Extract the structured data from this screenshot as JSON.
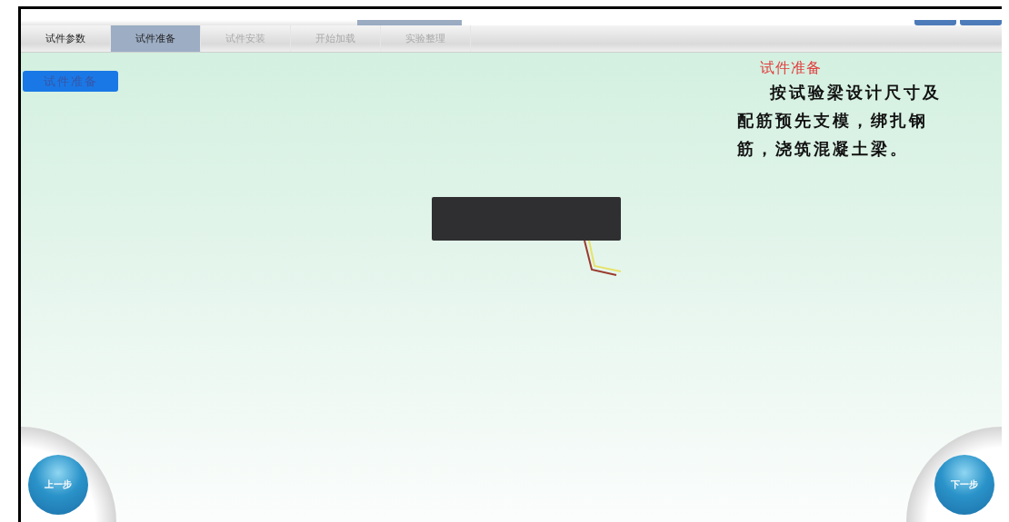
{
  "tabs": [
    {
      "label": "试件参数",
      "selected": false,
      "disabled": false
    },
    {
      "label": "试件准备",
      "selected": true,
      "disabled": false
    },
    {
      "label": "试件安装",
      "selected": false,
      "disabled": true
    },
    {
      "label": "开始加载",
      "selected": false,
      "disabled": true
    },
    {
      "label": "实验整理",
      "selected": false,
      "disabled": true
    }
  ],
  "step_badge": "试件准备",
  "info_panel": {
    "title": "试件准备",
    "text": "按试验梁设计尺寸及配筋预先支模，绑扎钢筋，浇筑混凝土梁。"
  },
  "nav": {
    "prev": "上一步",
    "next": "下一步"
  }
}
